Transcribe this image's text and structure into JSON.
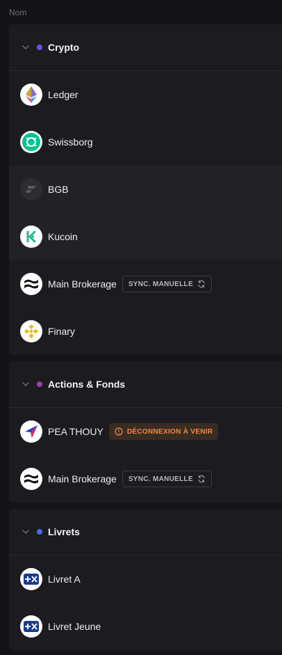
{
  "table": {
    "column_header": "Nom"
  },
  "groups": [
    {
      "title": "Crypto",
      "dot_color": "#6c4df5",
      "accounts": [
        {
          "name": "Ledger",
          "logo": "ethereum-logo"
        },
        {
          "name": "Swissborg",
          "logo": "swissborg-logo"
        },
        {
          "name": "BGB",
          "logo": "bitget-logo"
        },
        {
          "name": "Kucoin",
          "logo": "kucoin-logo"
        },
        {
          "name": "Main Brokerage",
          "logo": "wave-logo",
          "badge": "SYNC. MANUELLE"
        },
        {
          "name": "Finary",
          "logo": "binance-logo"
        }
      ]
    },
    {
      "title": "Actions & Fonds",
      "dot_color": "#a23ba6",
      "accounts": [
        {
          "name": "PEA THOUY",
          "logo": "arrow-logo",
          "warning": "DÉCONNEXION À VENIR"
        },
        {
          "name": "Main Brokerage",
          "logo": "wave-logo",
          "badge": "SYNC. MANUELLE"
        }
      ]
    },
    {
      "title": "Livrets",
      "dot_color": "#4a6cf0",
      "accounts": [
        {
          "name": "Livret A",
          "logo": "plusx-logo"
        },
        {
          "name": "Livret Jeune",
          "logo": "plusx-logo"
        }
      ]
    }
  ]
}
